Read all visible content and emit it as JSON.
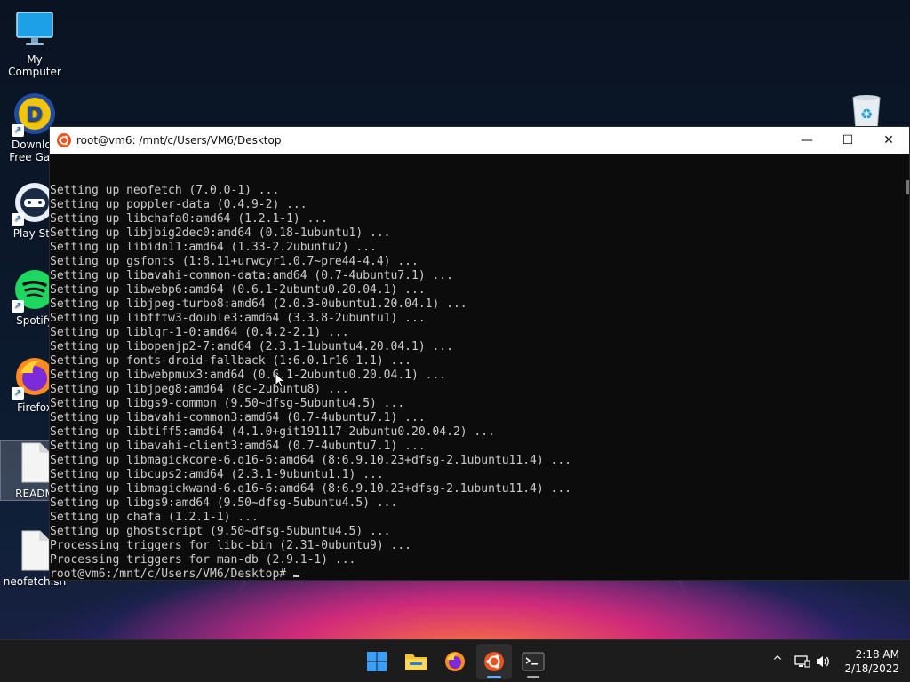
{
  "desktop": {
    "icons": [
      {
        "label": "My Computer",
        "icon": "monitor-icon"
      },
      {
        "label": "Downloa\nFree Gam",
        "icon": "download-app-icon"
      },
      {
        "label": "Play Sto",
        "icon": "play-store-icon"
      },
      {
        "label": "Spotify",
        "icon": "spotify-icon"
      },
      {
        "label": "Firefox",
        "icon": "firefox-icon"
      },
      {
        "label": "READM",
        "icon": "document-icon"
      },
      {
        "label": "neofetch.sh",
        "icon": "document-icon"
      }
    ],
    "recycle_bin_icon": "recycle-bin-icon"
  },
  "terminal": {
    "title": "root@vm6: /mnt/c/Users/VM6/Desktop",
    "controls": {
      "minimize": "—",
      "maximize": "☐",
      "close": "✕"
    },
    "lines": [
      "Setting up neofetch (7.0.0-1) ...",
      "Setting up poppler-data (0.4.9-2) ...",
      "Setting up libchafa0:amd64 (1.2.1-1) ...",
      "Setting up libjbig2dec0:amd64 (0.18-1ubuntu1) ...",
      "Setting up libidn11:amd64 (1.33-2.2ubuntu2) ...",
      "Setting up gsfonts (1:8.11+urwcyr1.0.7~pre44-4.4) ...",
      "Setting up libavahi-common-data:amd64 (0.7-4ubuntu7.1) ...",
      "Setting up libwebp6:amd64 (0.6.1-2ubuntu0.20.04.1) ...",
      "Setting up libjpeg-turbo8:amd64 (2.0.3-0ubuntu1.20.04.1) ...",
      "Setting up libfftw3-double3:amd64 (3.3.8-2ubuntu1) ...",
      "Setting up liblqr-1-0:amd64 (0.4.2-2.1) ...",
      "Setting up libopenjp2-7:amd64 (2.3.1-1ubuntu4.20.04.1) ...",
      "Setting up fonts-droid-fallback (1:6.0.1r16-1.1) ...",
      "Setting up libwebpmux3:amd64 (0.6.1-2ubuntu0.20.04.1) ...",
      "Setting up libjpeg8:amd64 (8c-2ubuntu8) ...",
      "Setting up libgs9-common (9.50~dfsg-5ubuntu4.5) ...",
      "Setting up libavahi-common3:amd64 (0.7-4ubuntu7.1) ...",
      "Setting up libtiff5:amd64 (4.1.0+git191117-2ubuntu0.20.04.2) ...",
      "Setting up libavahi-client3:amd64 (0.7-4ubuntu7.1) ...",
      "Setting up libmagickcore-6.q16-6:amd64 (8:6.9.10.23+dfsg-2.1ubuntu11.4) ...",
      "Setting up libcups2:amd64 (2.3.1-9ubuntu1.1) ...",
      "Setting up libmagickwand-6.q16-6:amd64 (8:6.9.10.23+dfsg-2.1ubuntu11.4) ...",
      "Setting up libgs9:amd64 (9.50~dfsg-5ubuntu4.5) ...",
      "Setting up chafa (1.2.1-1) ...",
      "Setting up ghostscript (9.50~dfsg-5ubuntu4.5) ...",
      "Processing triggers for libc-bin (2.31-0ubuntu9) ...",
      "Processing triggers for man-db (2.9.1-1) ..."
    ],
    "prompt": "root@vm6:/mnt/c/Users/VM6/Desktop#"
  },
  "taskbar": {
    "apps": [
      "windows-start-icon",
      "file-explorer-icon",
      "firefox-icon",
      "ubuntu-icon",
      "terminal-icon"
    ],
    "active_app": "ubuntu-icon",
    "tray": {
      "chevron": "^"
    },
    "clock": {
      "time": "2:18 AM",
      "date": "2/18/2022"
    }
  }
}
